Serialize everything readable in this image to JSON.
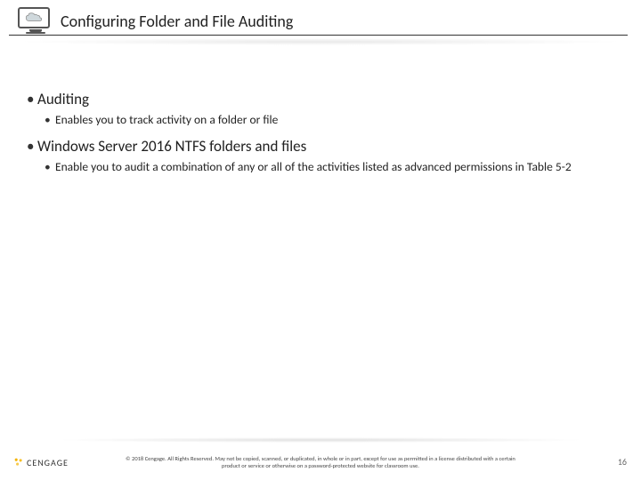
{
  "header": {
    "title": "Configuring Folder and File Auditing"
  },
  "content": {
    "items": [
      {
        "label": "Auditing",
        "sub": [
          "Enables you to track activity on a folder or file"
        ]
      },
      {
        "label": "Windows Server 2016 NTFS folders and files",
        "sub": [
          "Enable you to audit a combination of any or all of the activities listed as advanced permissions in Table 5-2"
        ]
      }
    ]
  },
  "footer": {
    "brand": "CENGAGE",
    "copyright": "© 2018 Cengage. All Rights Reserved. May not be copied, scanned, or duplicated, in whole or in part, except for use as permitted in a license distributed with a certain product or service or otherwise on a password-protected website for classroom use.",
    "page": "16"
  }
}
